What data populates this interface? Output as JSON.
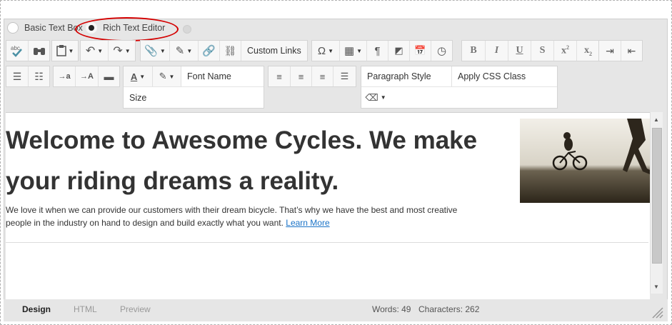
{
  "mode": {
    "basic_label": "Basic Text Box",
    "rich_label": "Rich Text Editor",
    "selected": "rich"
  },
  "toolbar": {
    "custom_links": "Custom Links",
    "font_name": "Font Name",
    "size": "Size",
    "paragraph_style": "Paragraph Style",
    "apply_css_class": "Apply CSS Class",
    "icons": [
      "spellcheck-icon",
      "find-icon",
      "paste-icon",
      "undo-icon",
      "redo-icon",
      "attach-icon",
      "edit-icon",
      "link-icon",
      "unlink-icon",
      "omega-icon",
      "table-icon",
      "pilcrow-icon",
      "media-icon",
      "calendar-icon",
      "clock-icon",
      "bold-icon",
      "italic-icon",
      "underline-icon",
      "strikethrough-icon",
      "superscript-icon",
      "subscript-icon",
      "indent-icon",
      "outdent-icon",
      "ordered-list-icon",
      "unordered-list-icon",
      "decrease-font-icon",
      "increase-font-icon",
      "horizontal-rule-icon",
      "font-color-icon",
      "highlight-icon",
      "align-left-icon",
      "align-center-icon",
      "align-right-icon",
      "justify-icon",
      "eraser-icon"
    ]
  },
  "content": {
    "heading": "Welcome to Awesome Cycles. We make your riding dreams a reality.",
    "paragraph": "We love it when we can provide our customers with their dream bicycle. That’s why we have the best and most creative people in the industry on hand to design and build exactly what you want. ",
    "link_text": "Learn More"
  },
  "footer": {
    "tabs": [
      "Design",
      "HTML",
      "Preview"
    ],
    "active_tab": "Design",
    "words": "Words: 49",
    "characters": "Characters: 262"
  },
  "colors": {
    "annotation_oval": "#d40000",
    "link": "#1a73c7",
    "chrome": "#e6e6e6"
  }
}
